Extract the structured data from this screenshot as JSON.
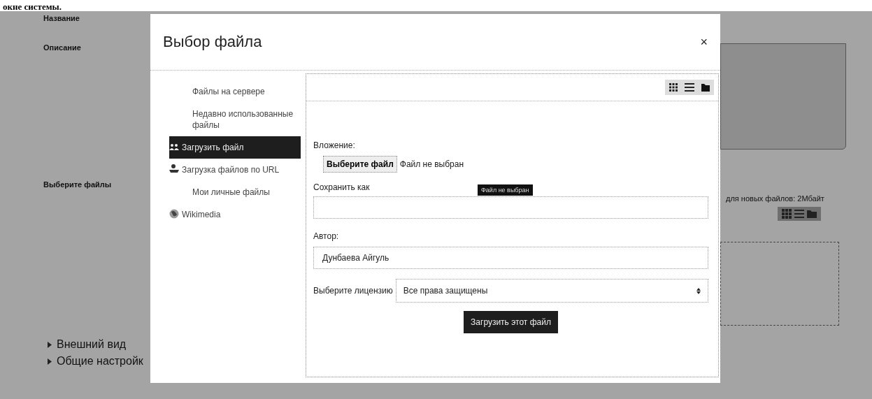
{
  "document_caption": "окне системы.",
  "background_form": {
    "fields": [
      "Название",
      "Описание",
      "Выберите файлы"
    ],
    "max_size_note": "для новых файлов: 2Мбайт",
    "sections": [
      "Внешний вид",
      "Общие настройк"
    ]
  },
  "dialog": {
    "title": "Выбор файла",
    "close": "×",
    "repositories": [
      {
        "label": "Файлы на сервере",
        "selected": false
      },
      {
        "label": "Недавно использованные файлы",
        "selected": false
      },
      {
        "label": "Загрузить файл",
        "selected": true
      },
      {
        "label": "Загрузка файлов по URL",
        "selected": false
      },
      {
        "label": "Мои личные файлы",
        "selected": false
      },
      {
        "label": "Wikimedia",
        "selected": false
      }
    ],
    "upload_form": {
      "attachment_label": "Вложение:",
      "choose_button": "Выберите файл",
      "file_status": "Файл не выбран",
      "tooltip": "Файл не выбран",
      "save_as_label": "Сохранить как",
      "author_label": "Автор:",
      "author_value": "Дунбаева Айгуль",
      "license_label": "Выберите лицензию",
      "license_value": "Все права защищены",
      "submit_button": "Загрузить этот файл"
    }
  }
}
